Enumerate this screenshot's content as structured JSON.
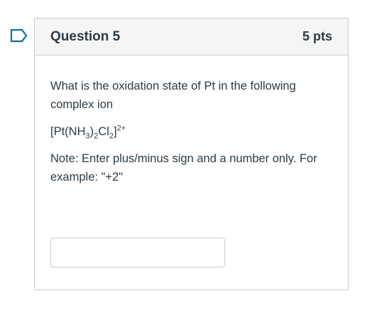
{
  "question": {
    "title": "Question 5",
    "points": "5 pts",
    "prompt": "What is the oxidation state of Pt in the following complex ion",
    "formula": {
      "prefix": "[Pt(NH",
      "sub1": "3",
      "mid1": ")",
      "sub2": "2",
      "mid2": "Cl",
      "sub3": "2",
      "suffix": "]",
      "charge": "2+"
    },
    "note": "Note: Enter plus/minus sign and a number only. For example: \"+2\"",
    "answer_value": "",
    "answer_placeholder": ""
  },
  "icons": {
    "bookmark": "bookmark-flag-icon"
  },
  "colors": {
    "accent": "#0770A3",
    "border": "#C7CDD1",
    "header_bg": "#F5F5F5",
    "text": "#2D3B45"
  }
}
